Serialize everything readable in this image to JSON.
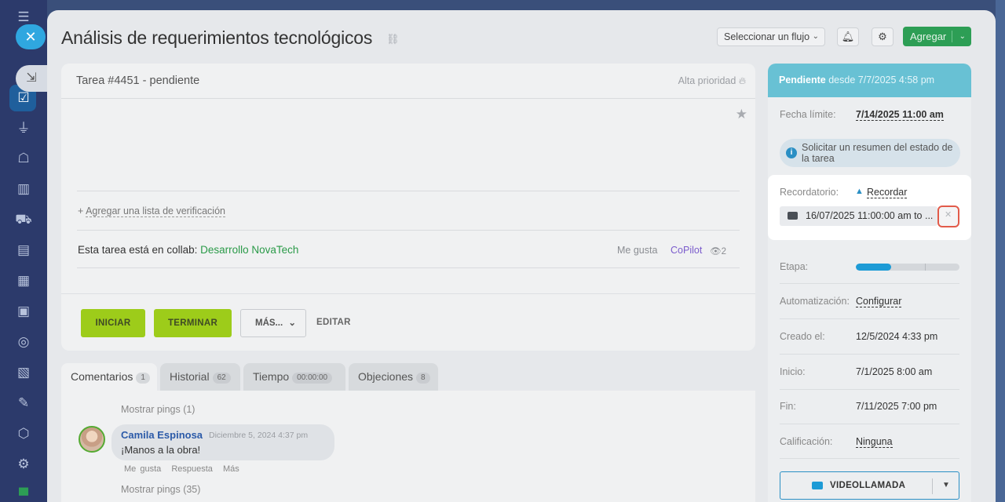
{
  "title": "Análisis de requerimientos tecnológicos",
  "header": {
    "flow_select": "Seleccionar un flujo",
    "add_label": "Agregar"
  },
  "task": {
    "id_status": "Tarea #4451 - pendiente",
    "priority": "Alta prioridad",
    "checklist": "Agregar una lista de verificación",
    "collab_prefix": "Esta tarea está en collab:",
    "collab_name": "Desarrollo NovaTech",
    "like": "Me gusta",
    "copilot": "CoPilot",
    "views": "2",
    "buttons": {
      "start": "INICIAR",
      "finish": "TERMINAR",
      "more": "MÁS...",
      "edit": "EDITAR"
    }
  },
  "tabs": [
    {
      "label": "Comentarios",
      "count": "1"
    },
    {
      "label": "Historial",
      "count": "62"
    },
    {
      "label": "Tiempo",
      "count": "00:00:00"
    },
    {
      "label": "Objeciones",
      "count": "8"
    }
  ],
  "comments": {
    "show_pings_top": "Mostrar pings (1)",
    "author": "Camila Espinosa",
    "date": "Diciembre 5, 2024 4:37 pm",
    "text": "¡Manos a la obra!",
    "actions": {
      "like": "Me gusta",
      "reply": "Respuesta",
      "more": "Más"
    },
    "show_pings_bottom": "Mostrar pings (35)"
  },
  "info": {
    "status": "Pendiente",
    "status_since": "desde 7/7/2025 4:58 pm",
    "deadline_label": "Fecha límite:",
    "deadline_value": "7/14/2025 11:00 am",
    "summary_request": "Solicitar un resumen del estado de la tarea",
    "reminder_label": "Recordatorio:",
    "reminder_action": "Recordar",
    "reminder_value": "16/07/2025 11:00:00 am to ...",
    "stage_label": "Etapa:",
    "stage_progress": 0.34,
    "automation_label": "Automatización:",
    "automation_value": "Configurar",
    "created_label": "Creado el:",
    "created_value": "12/5/2024 4:33 pm",
    "start_label": "Inicio:",
    "start_value": "7/1/2025 8:00 am",
    "end_label": "Fin:",
    "end_value": "7/11/2025 7:00 pm",
    "rating_label": "Calificación:",
    "rating_value": "Ninguna",
    "video_call": "VIDEOLLAMADA"
  },
  "colors": {
    "accent_blue": "#2fa7e0",
    "status_teal": "#68c1d4",
    "action_green": "#9dcc1a",
    "add_green": "#2d9e55",
    "highlight_red": "#e25b4a"
  }
}
